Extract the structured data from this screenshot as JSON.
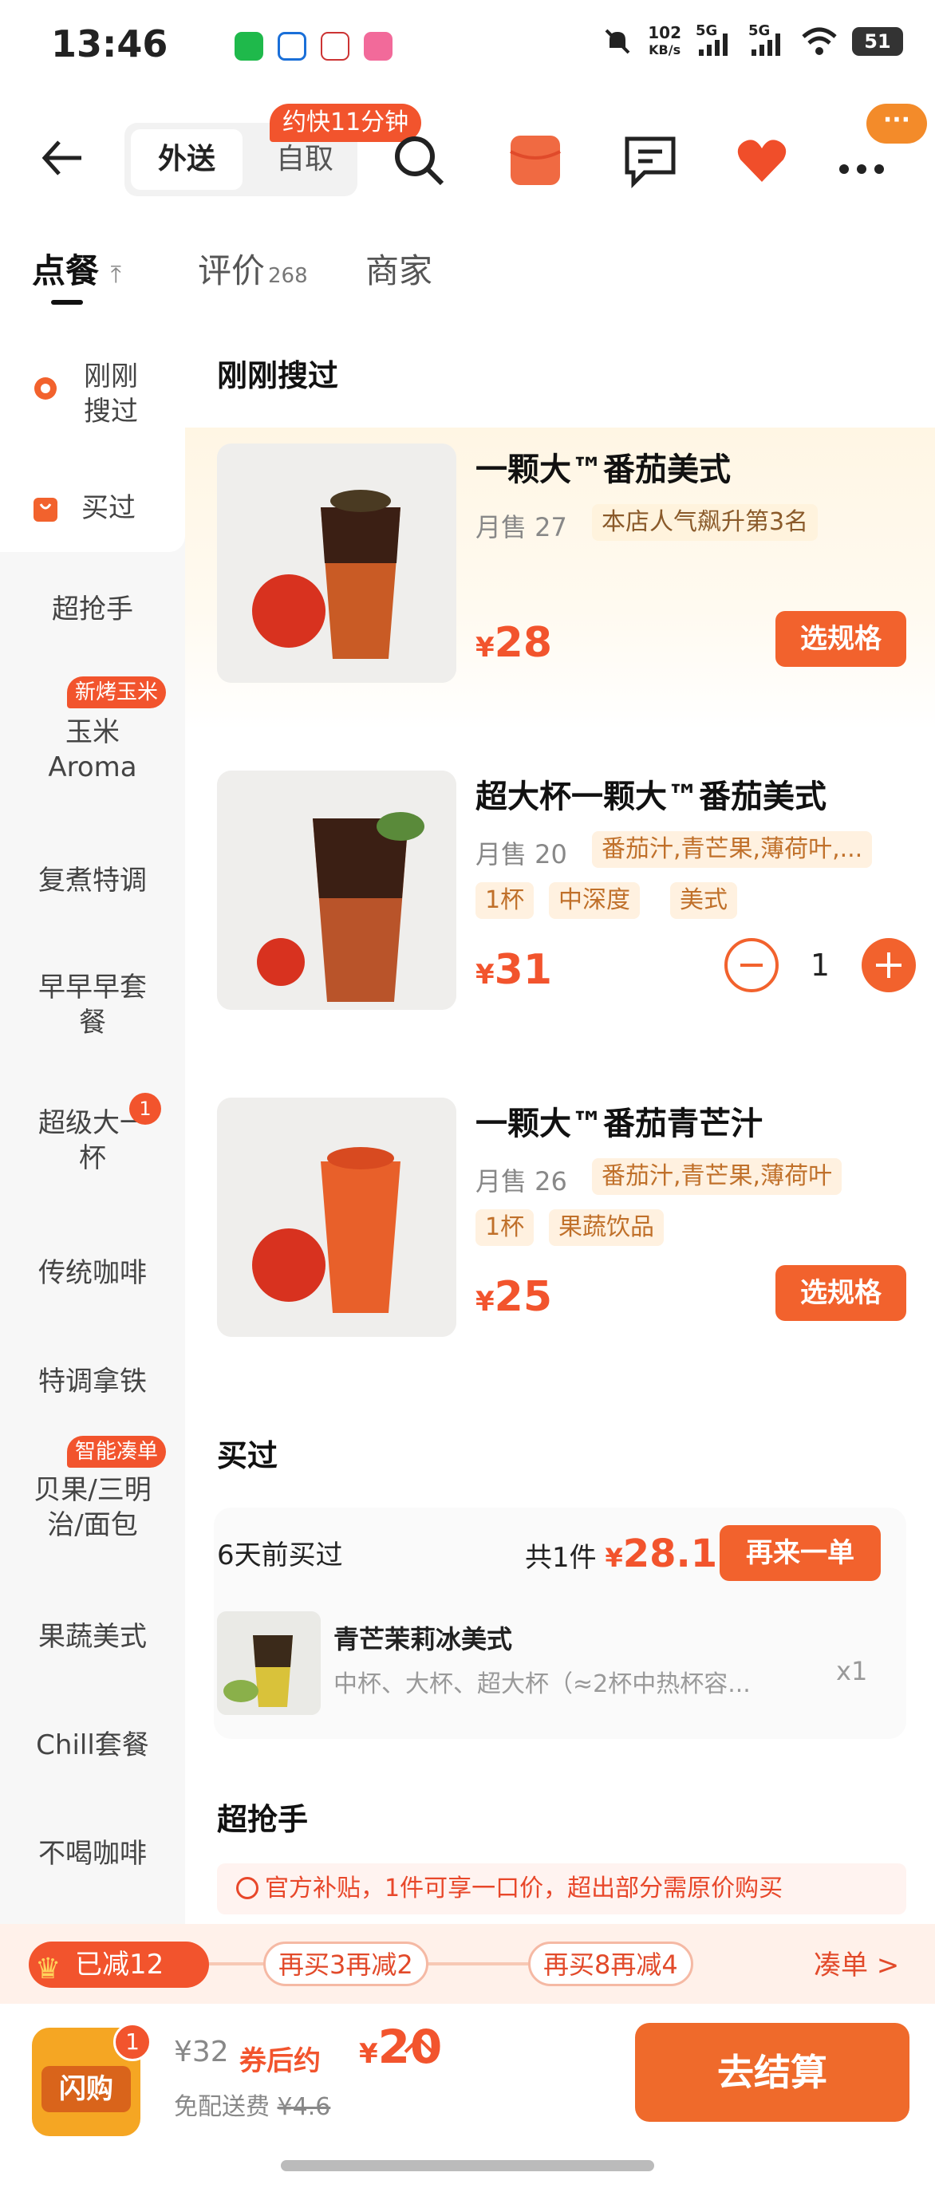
{
  "status_bar": {
    "time": "13:46",
    "net_speed_value": "102",
    "net_speed_unit": "KB/s",
    "signal1": "5G",
    "signal2": "5G",
    "battery": "51"
  },
  "nav": {
    "tab_delivery": "外送",
    "tab_pickup": "自取",
    "bubble": "约快11分钟",
    "more_badge": "···"
  },
  "tabs": {
    "order": "点餐",
    "reviews": "评价",
    "reviews_count": "268",
    "merchant": "商家"
  },
  "sidebar": {
    "items": [
      {
        "label": "刚刚\n搜过",
        "icon": "eye-icon"
      },
      {
        "label": "买过",
        "icon": "bag-icon"
      },
      {
        "label": "超抢手"
      },
      {
        "label": "玉米\nAroma",
        "badge": "新烤玉米"
      },
      {
        "label": "复煮特调"
      },
      {
        "label": "早早早套\n餐"
      },
      {
        "label": "超级大一\n杯",
        "count": "1"
      },
      {
        "label": "传统咖啡"
      },
      {
        "label": "特调拿铁"
      },
      {
        "label": "贝果/三明\n治/面包",
        "badge": "智能凑单"
      },
      {
        "label": "果蔬美式"
      },
      {
        "label": "Chill套餐"
      },
      {
        "label": "不喝咖啡"
      }
    ]
  },
  "sections": {
    "recent": "刚刚搜过",
    "bought": "买过",
    "hot": "超抢手"
  },
  "products": [
    {
      "name": "一颗大™番茄美式",
      "sales": "月售 27",
      "tags": [
        "本店人气飙升第3名"
      ],
      "price": "28",
      "button": "选规格"
    },
    {
      "name": "超大杯一颗大™番茄美式",
      "sales": "月售 20",
      "tags": [
        "番茄汁,青芒果,薄荷叶,...",
        "1杯",
        "中深度",
        "美式"
      ],
      "price": "31",
      "qty": "1"
    },
    {
      "name": "一颗大™番茄青芒汁",
      "sales": "月售 26",
      "tags": [
        "番茄汁,青芒果,薄荷叶",
        "1杯",
        "果蔬饮品"
      ],
      "price": "25",
      "button": "选规格"
    }
  ],
  "bought_card": {
    "when": "6天前买过",
    "total_label": "共1件",
    "currency": "¥",
    "total_price": "28.1",
    "reorder": "再来一单",
    "item_name": "青芒茉莉冰美式",
    "item_spec": "中杯、大杯、超大杯（≈2杯中热杯容...",
    "item_qty": "x1"
  },
  "notice": "官方补贴，1件可享一口价，超出部分需原价购买",
  "promo": {
    "current": "已减12",
    "step1": "再买3再减2",
    "step2": "再买8再减4",
    "link": "凑单 >"
  },
  "bottom": {
    "bag_label": "闪购",
    "bag_count": "1",
    "original": "¥32",
    "after_label": "券后约",
    "after_currency": "¥",
    "after_price": "20",
    "shipping": "免配送费",
    "shipping_orig": "¥4.6",
    "checkout": "去结算"
  },
  "colors": {
    "accent": "#f2542d",
    "button": "#f2622d",
    "checkout": "#ef6a2b"
  }
}
